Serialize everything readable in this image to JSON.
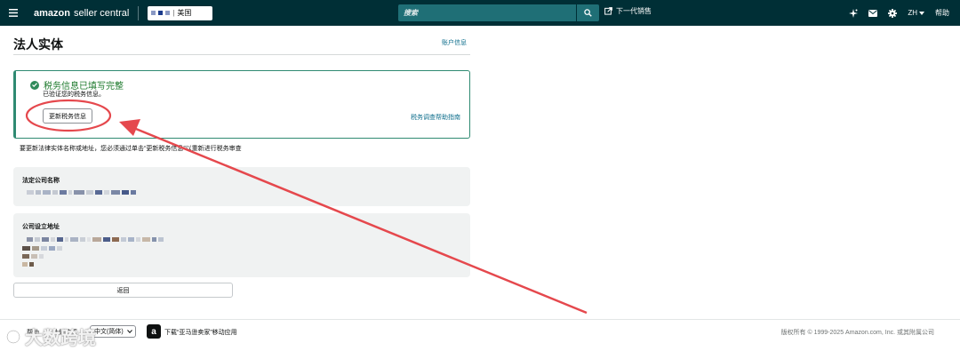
{
  "nav": {
    "logo_bold": "amazon",
    "logo_light": "seller central",
    "store_region": "美国",
    "search_placeholder": "搜索",
    "next_gen_label": "下一代销售",
    "lang_code": "ZH",
    "help_label": "帮助"
  },
  "page": {
    "title": "法人实体",
    "account_info_link": "账户信息"
  },
  "tax_status": {
    "title": "税务信息已填写完整",
    "subtitle": "已验证您的税务信息。",
    "update_button": "更新税务信息",
    "guide_link": "税务调查帮助指南"
  },
  "note": "要更新法律实体名称或地址，您必须通过单击“更新税务信息”以重新进行税务审查",
  "legal_name": {
    "label": "法定公司名称"
  },
  "address": {
    "label": "公司设立地址"
  },
  "back_button": "返回",
  "footer": {
    "help": "帮助",
    "program_policy": "计划政策",
    "language": "中文(简体)",
    "download_app": "下载“亚马逊卖家”移动应用",
    "copyright": "版权所有 © 1999-2025 Amazon.com, Inc. 或其附属公司"
  },
  "watermark": "大数跨境",
  "colors": {
    "nav_bg": "#002f36",
    "search_bg": "#1f6f76",
    "success_border": "#2f8a72",
    "success_text": "#1d7a2c",
    "link": "#0e6e8c",
    "panel_bg": "#f0f2f2",
    "annotation": "#e5484d"
  },
  "icons": [
    "menu-icon",
    "search-icon",
    "external-link-icon",
    "sparkle-icon",
    "mail-icon",
    "gear-icon",
    "chevron-down-icon",
    "check-circle-icon",
    "amazon-app-icon"
  ]
}
